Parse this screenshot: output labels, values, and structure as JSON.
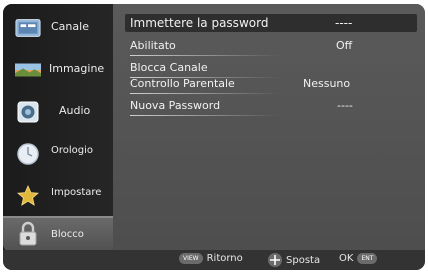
{
  "sidebar": {
    "items": [
      {
        "label": "Canale",
        "icon": "tv-channel-icon"
      },
      {
        "label": "Immagine",
        "icon": "picture-icon"
      },
      {
        "label": "Audio",
        "icon": "speaker-icon"
      },
      {
        "label": "Orologio",
        "icon": "clock-icon"
      },
      {
        "label": "Impostare",
        "icon": "star-settings-icon"
      },
      {
        "label": "Blocco",
        "icon": "padlock-icon"
      }
    ],
    "active_index": 5
  },
  "menu": {
    "password_prompt": {
      "label": "Immettere la password",
      "value": "----"
    },
    "abilitato": {
      "label": "Abilitato",
      "value": "Off"
    },
    "blocca_canale": {
      "label": "Blocca Canale"
    },
    "controllo_parentale": {
      "label": "Controllo Parentale",
      "value": "Nessuno"
    },
    "nuova_password": {
      "label": "Nuova Password",
      "value": "----"
    }
  },
  "footer": {
    "return_key": "VIEW",
    "return_label": "Ritorno",
    "move_label": "Sposta",
    "ok_label": "OK",
    "ok_key": "ENT"
  },
  "colors": {
    "screen_bg": "#4c4c4c",
    "sidebar_bg": "#1f1f1f",
    "selected_row": "#2e2e2e",
    "text": "#f2f2f2"
  }
}
